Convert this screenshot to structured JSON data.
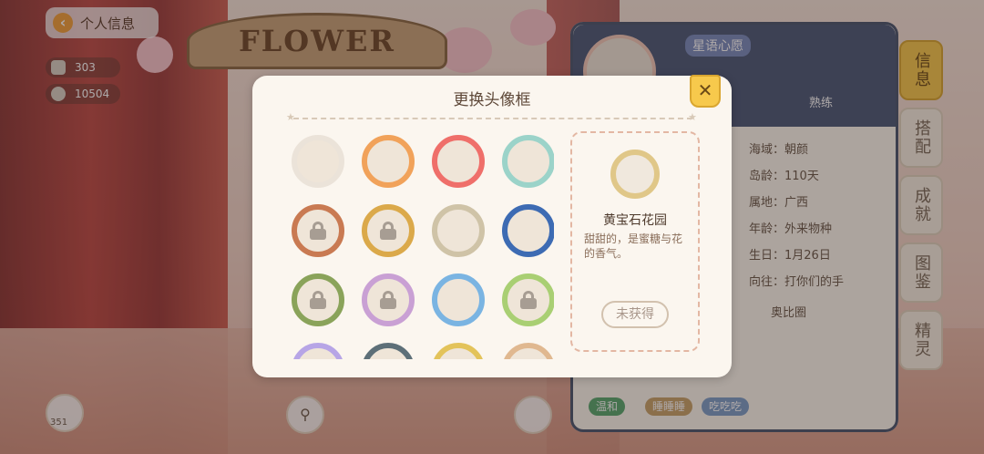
{
  "background": {
    "banner_text": "FLOWER"
  },
  "top_left": {
    "back_label": "个人信息",
    "stats": [
      {
        "icon": "coin-stack-icon",
        "value": "303"
      },
      {
        "icon": "moon-icon",
        "value": "10504"
      }
    ]
  },
  "profile_panel": {
    "name": "星语心愿",
    "action_label": "熟练",
    "info_rows": [
      "海域：朝颜",
      "岛龄：110天",
      "属地：广西",
      "年龄：外来物种",
      "生日：1月26日",
      "向往：打你们的手"
    ],
    "friends_title": "奥比圈",
    "tags": [
      {
        "label": "温和",
        "color": "#58a86e"
      },
      {
        "label": "睡睡睡",
        "color": "#c9a36a"
      },
      {
        "label": "吃吃吃",
        "color": "#7c9ec9"
      }
    ],
    "side_tabs": [
      "信息",
      "搭配",
      "成就",
      "图鉴",
      "精灵"
    ],
    "active_tab": "信息",
    "bottom_count": "351"
  },
  "modal": {
    "title": "更换头像框",
    "close_icon": "close-icon",
    "frames": [
      {
        "color": "#e8e0d6",
        "locked": false,
        "empty": true
      },
      {
        "color": "#f1a25a",
        "locked": false
      },
      {
        "color": "#ef6f6a",
        "locked": false
      },
      {
        "color": "#9bd3c9",
        "locked": false
      },
      {
        "color": "#c97a52",
        "locked": true
      },
      {
        "color": "#dba94a",
        "locked": true
      },
      {
        "color": "#cfc3a7",
        "locked": false
      },
      {
        "color": "#3d6bb3",
        "locked": false
      },
      {
        "color": "#8aa35a",
        "locked": true
      },
      {
        "color": "#c9a0d4",
        "locked": true
      },
      {
        "color": "#7ab4e2",
        "locked": false
      },
      {
        "color": "#a9cf73",
        "locked": true
      },
      {
        "color": "#b7a5e6",
        "locked": false
      },
      {
        "color": "#5d6f78",
        "locked": false
      },
      {
        "color": "#e3c35a",
        "locked": false
      },
      {
        "color": "#e0b890",
        "locked": false
      }
    ],
    "selected": {
      "name": "黄宝石花园",
      "description": "甜甜的，是蜜糖与花的香气。",
      "status": "未获得"
    }
  }
}
